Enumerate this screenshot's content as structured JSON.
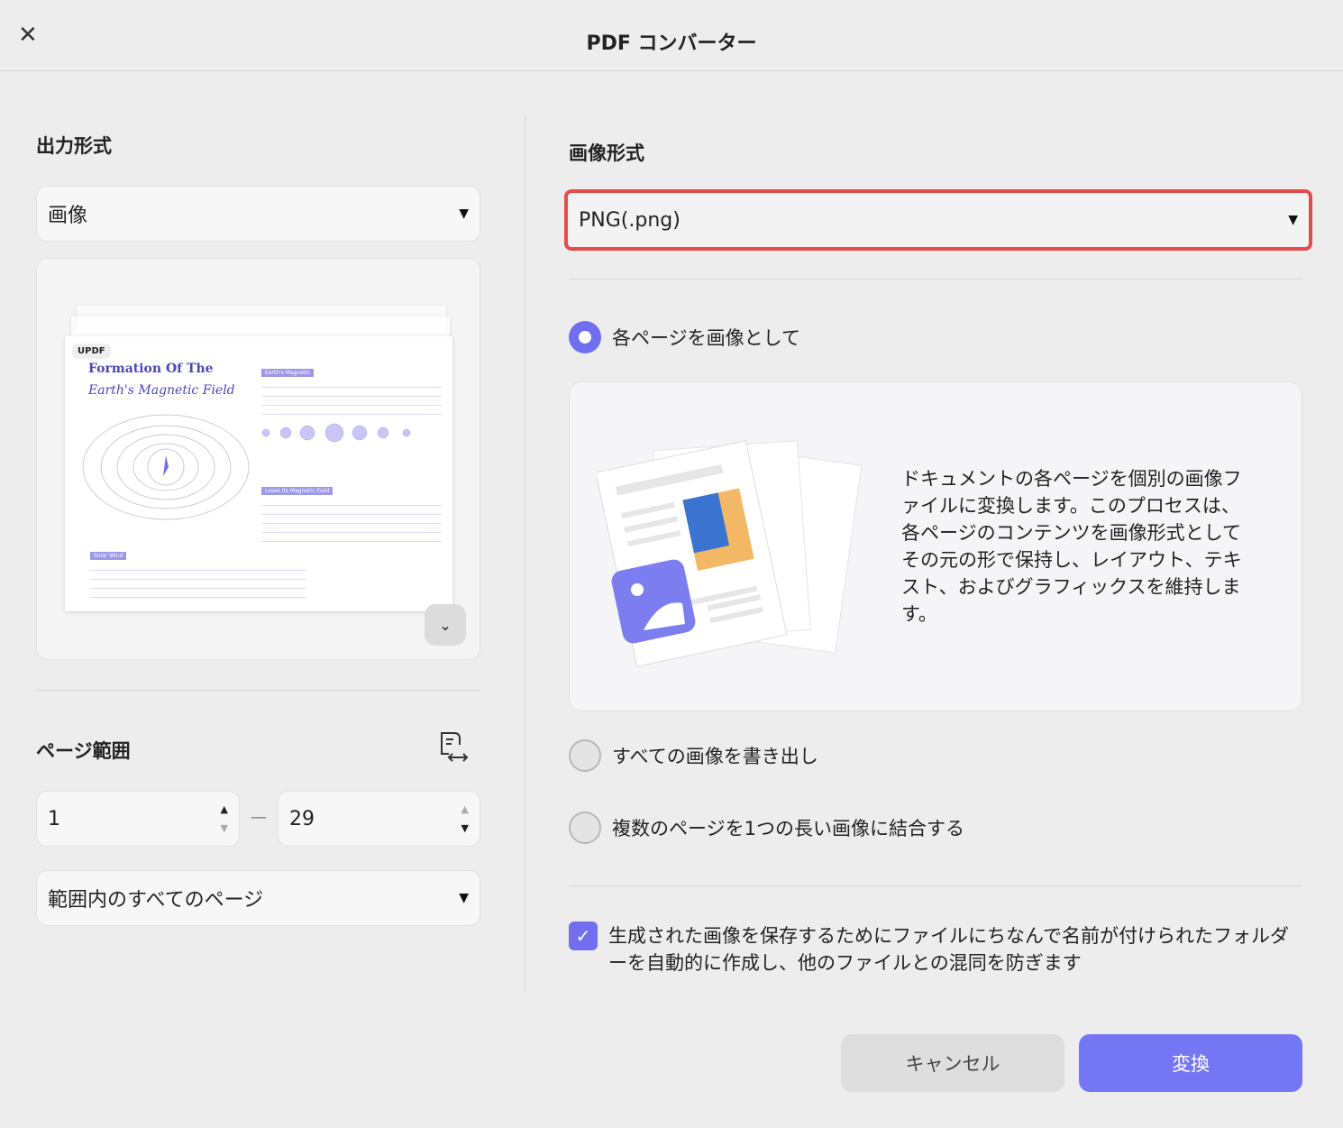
{
  "header": {
    "title": "PDF コンバーター",
    "close_icon": "close-icon"
  },
  "left": {
    "output_format_heading": "出力形式",
    "output_format_value": "画像",
    "preview": {
      "logo": "UPDF",
      "title_line1": "Formation Of The",
      "title_line2": "Earth's Magnetic Field",
      "tag1": "Earth's Magnetic",
      "tag2": "Loses Its Magnetic Field",
      "tag3": "Solar Wind"
    },
    "page_range_heading": "ページ範囲",
    "range_from": "1",
    "range_dash": "—",
    "range_to": "29",
    "range_mode": "範囲内のすべてのページ"
  },
  "right": {
    "image_format_heading": "画像形式",
    "image_format_value": "PNG(.png)",
    "options": [
      {
        "label": "各ページを画像として",
        "selected": true
      },
      {
        "label": "すべての画像を書き出し",
        "selected": false
      },
      {
        "label": "複数のページを1つの長い画像に結合する",
        "selected": false
      }
    ],
    "description": "ドキュメントの各ページを個別の画像ファイルに変換します。このプロセスは、各ページのコンテンツを画像形式としてその元の形で保持し、レイアウト、テキスト、およびグラフィックスを維持します。",
    "checkbox_label": "生成された画像を保存するためにファイルにちなんで名前が付けられたフォルダーを自動的に作成し、他のファイルとの混同を防ぎます",
    "checkbox_checked": true
  },
  "footer": {
    "cancel": "キャンセル",
    "convert": "変換"
  },
  "colors": {
    "accent": "#6f6ff0",
    "highlight": "#e84a4a"
  }
}
